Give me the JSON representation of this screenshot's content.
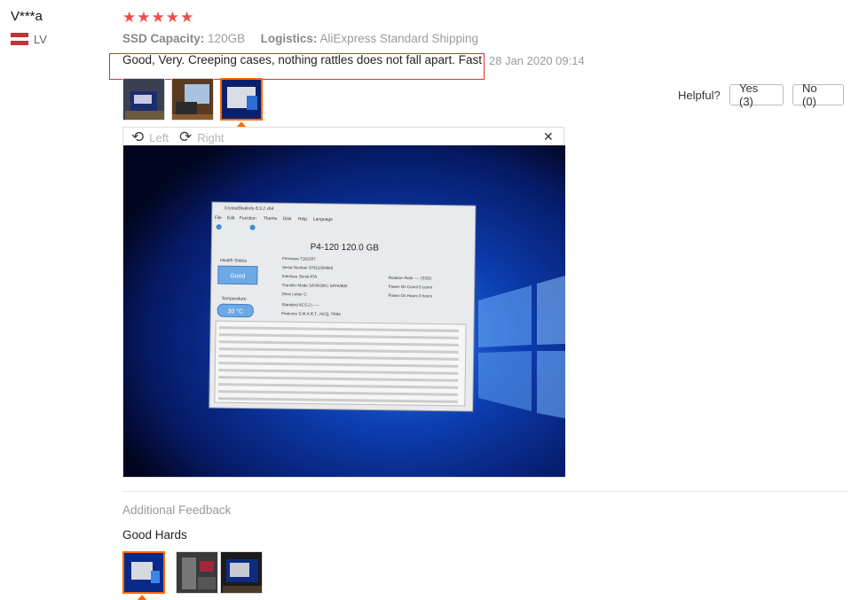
{
  "review": {
    "user_name": "V***a",
    "country_code": "LV",
    "stars": "★★★★★",
    "rating": 5,
    "attr1_key": "SSD Capacity:",
    "attr1_val": "120GB",
    "attr2_key": "Logistics:",
    "attr2_val": "AliExpress Standard Shipping",
    "text": "Good, Very. Creeping cases, nothing rattles does not fall apart. Fast",
    "date": "28 Jan 2020 09:14"
  },
  "helpful": {
    "label": "Helpful?",
    "yes": "Yes (3)",
    "no": "No (0)"
  },
  "viewer": {
    "left": "Left",
    "right": "Right",
    "close": "✕"
  },
  "screen": {
    "app_title": "CrystalDiskInfo 8.3.2 x64",
    "menu": [
      "File",
      "Edit",
      "Function",
      "Theme",
      "Disk",
      "Help",
      "Language"
    ],
    "disk_title": "P4-120 120.0 GB",
    "health_label": "Health Status",
    "health": "Good",
    "temp_label": "Temperature",
    "temp": "30 °C",
    "firmware": "Firmware T181207",
    "serial": "Serial Number 97611004863",
    "interface": "Interface Serial ATA",
    "transfer": "Transfer Mode SATA/300 | SATA/600",
    "drive_letter": "Drive Letter C:",
    "standard": "Standard ACS-2 | ----",
    "features": "Features S.M.A.R.T., NCQ, TRIM",
    "rotation": "Rotation Rate ---- (SSD)",
    "power_count": "Power On Count 5 count",
    "power_hours": "Power On Hours 0 hours"
  },
  "additional": {
    "title": "Additional Feedback",
    "text": "Good Hards"
  },
  "colors": {
    "accent": "#ff6a00",
    "star": "#f34b4b",
    "highlight_box": "#d9322f"
  }
}
